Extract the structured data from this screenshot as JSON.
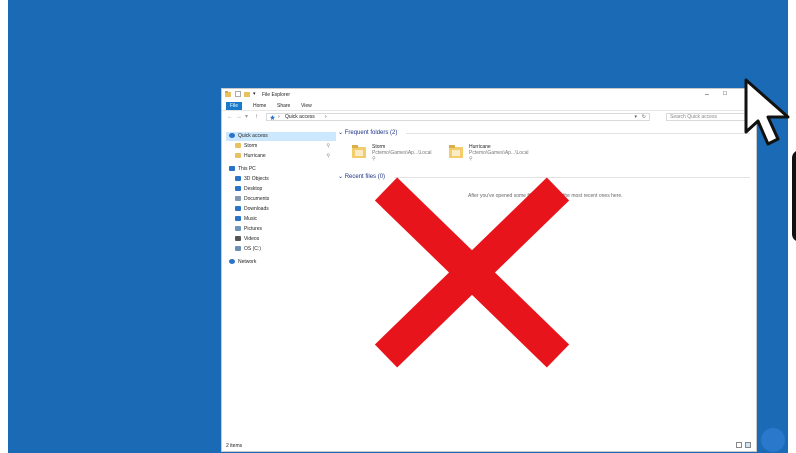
{
  "window": {
    "title": "File Explorer",
    "controls": {
      "minimize": "–",
      "maximize": "☐"
    }
  },
  "ribbon": {
    "tabs": [
      "File",
      "Home",
      "Share",
      "View"
    ]
  },
  "address": {
    "path": "Quick access",
    "search_placeholder": "Search Quick access"
  },
  "nav_pane": {
    "items": [
      {
        "label": "Quick access",
        "icon": "star-icon",
        "color": "#2a73c7"
      },
      {
        "label": "Storm",
        "icon": "folder-icon",
        "color": "#e8c261"
      },
      {
        "label": "Hurricane",
        "icon": "folder-icon",
        "color": "#e8c261"
      },
      {
        "label": "This PC",
        "icon": "pc-icon",
        "color": "#2a73c7"
      },
      {
        "label": "3D Objects",
        "icon": "cube-icon",
        "color": "#2a73c7"
      },
      {
        "label": "Desktop",
        "icon": "desktop-icon",
        "color": "#2a73c7"
      },
      {
        "label": "Documents",
        "icon": "documents-icon",
        "color": "#7f97b0"
      },
      {
        "label": "Downloads",
        "icon": "download-icon",
        "color": "#2a73c7"
      },
      {
        "label": "Music",
        "icon": "music-icon",
        "color": "#2a73c7"
      },
      {
        "label": "Pictures",
        "icon": "pictures-icon",
        "color": "#6e94b9"
      },
      {
        "label": "Videos",
        "icon": "videos-icon",
        "color": "#555555"
      },
      {
        "label": "OS (C:)",
        "icon": "drive-icon",
        "color": "#6c8fb5"
      },
      {
        "label": "Network",
        "icon": "network-icon",
        "color": "#2a73c7"
      }
    ]
  },
  "content": {
    "frequent_header": "Frequent folders (2)",
    "folders": [
      {
        "name": "Storm",
        "path": "Pctemo\\Games\\Ap...\\Local"
      },
      {
        "name": "Hurricane",
        "path": "Pctemo\\Games\\Ap...\\Local"
      }
    ],
    "recent_header": "Recent files (0)",
    "recent_message": "After you've opened some files, we'll show the most recent ones here."
  },
  "status": {
    "items": "2 items"
  },
  "colors": {
    "desktop": "#1b6ab5",
    "accent": "#1979ca",
    "selection": "#cce8ff",
    "red_x": "#e8141c"
  }
}
